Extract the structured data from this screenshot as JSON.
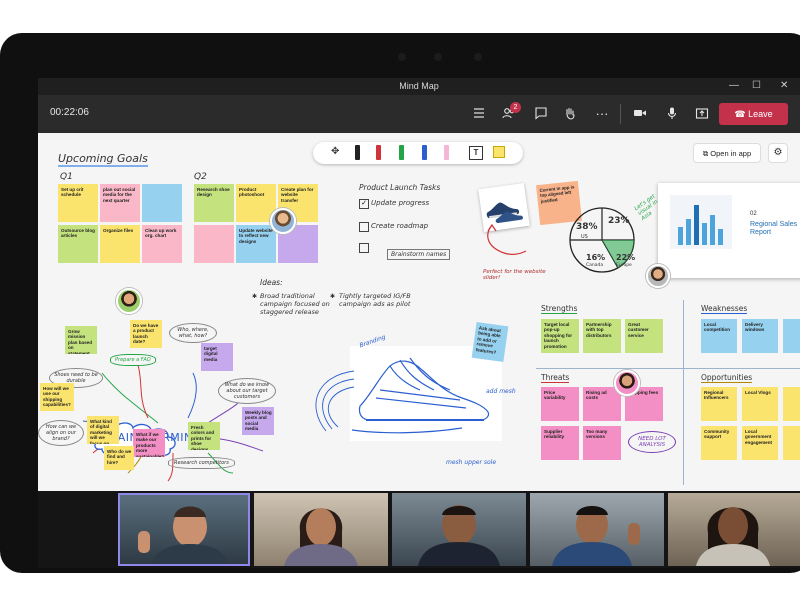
{
  "window": {
    "title": "Mind Map"
  },
  "meeting": {
    "timer": "00:22:06",
    "participants_badge": "2",
    "leave_label": "Leave"
  },
  "colors": {
    "leave": "#c4314b",
    "meet_bar": "#2b2b2b",
    "board": "#f5f5f5"
  },
  "board": {
    "upcoming_title": "Upcoming Goals",
    "q1_label": "Q1",
    "q2_label": "Q2",
    "q1_notes": [
      "Set up crit schedule",
      "plan out social media for the next quarter",
      "",
      "Outsource blog articles",
      "Organize files",
      "Clean up work org. chart"
    ],
    "q2_notes": [
      "Research shoe design",
      "Product photoshoot",
      "Create plan for website transfer",
      "",
      "Update website to reflect new designs",
      ""
    ],
    "tasks_title": "Product Launch Tasks",
    "tasks": [
      "Update progress",
      "Create roadmap",
      ""
    ],
    "brainstorm_names": "Brainstorm names",
    "current_app_note": "Current in app is top aligned left justified",
    "perfect_website_slider": "Perfect for the website slider!",
    "lets_get_visual": "Let's get visual in Asia",
    "pie_labels": [
      "38%",
      "23%",
      "16%",
      "22%"
    ],
    "pie_sublabels": [
      "US",
      "Canada",
      "Europe"
    ],
    "ideas_title": "Ideas:",
    "idea1": "Broad traditional campaign focused on staggered release",
    "idea2": "Tightly targeted IG/FB campaign ads as pilot",
    "open_in_app": "Open in app",
    "report_number": "02",
    "report_title": "Regional Sales Report",
    "brainstorming": "BRAINSTORMING",
    "brainstorm_notes": [
      "Grow mission plan based on statement",
      "Do we have a product launch date?",
      "Who, where, what, how?",
      "target digital media",
      "What do we know about our target customers",
      "How can we align on our brand?",
      "Weekly blog posts and social media",
      "Fresh colors and prints for shoe designs",
      "What kind of digital marketing will we focus on",
      "What if we make our products more sustainable?",
      "Who do we find and hire?",
      "How will we use our shipping capabilities?"
    ],
    "bubbles": [
      "Prepare a FAQ",
      "Shoes need to be durable",
      "Research competitors"
    ],
    "ask_note": "Ask about being able to add or remove features?",
    "add_mesh": "add mesh",
    "mesh_soles": "mesh upper sole",
    "branding": "Branding",
    "strengths_title": "Strengths",
    "strengths_notes": [
      "Target local pop-up shopping for launch promotion",
      "Partnership with top distributors",
      "Great customer service"
    ],
    "weaknesses_title": "Weaknesses",
    "weaknesses_notes": [
      "Local competition",
      "Delivery windows",
      ""
    ],
    "threats_title": "Threats",
    "threats_notes": [
      "Price variability",
      "Rising ad costs",
      "Shipping fees",
      "Supplier reliability",
      "Too many versions"
    ],
    "need_analysis": "NEED LOT ANALYSIS",
    "opportunities_title": "Opportunities",
    "opportunities_notes": [
      "Regional Influencers",
      "Local Vlogs",
      "",
      "Community support",
      "Local government engagement",
      ""
    ]
  },
  "icons": [
    "participants-list-icon",
    "people-icon",
    "chat-icon",
    "raise-hand-icon",
    "more-icon",
    "camera-icon",
    "mic-icon",
    "share-icon",
    "phone-hangup-icon",
    "lasso-icon",
    "pen-icon",
    "highlighter-icon",
    "text-icon",
    "sticky-note-icon",
    "open-in-app-icon",
    "gear-icon"
  ]
}
